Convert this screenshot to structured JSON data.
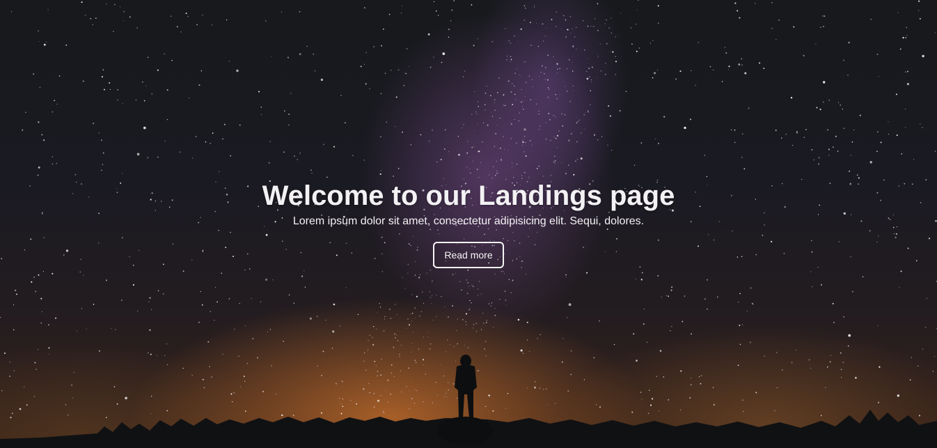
{
  "hero": {
    "title": "Welcome to our Landings page",
    "subtitle": "Lorem ipsum dolor sit amet, consectetur adipisicing elit. Sequi, dolores.",
    "button_label": "Read more"
  },
  "colors": {
    "text": "#f3f1f4",
    "button_border": "#f5f5f5",
    "sky_dark": "#17191c",
    "galaxy_glow": "#965aaa",
    "horizon_glow": "#cd732d",
    "silhouette": "#101113"
  }
}
